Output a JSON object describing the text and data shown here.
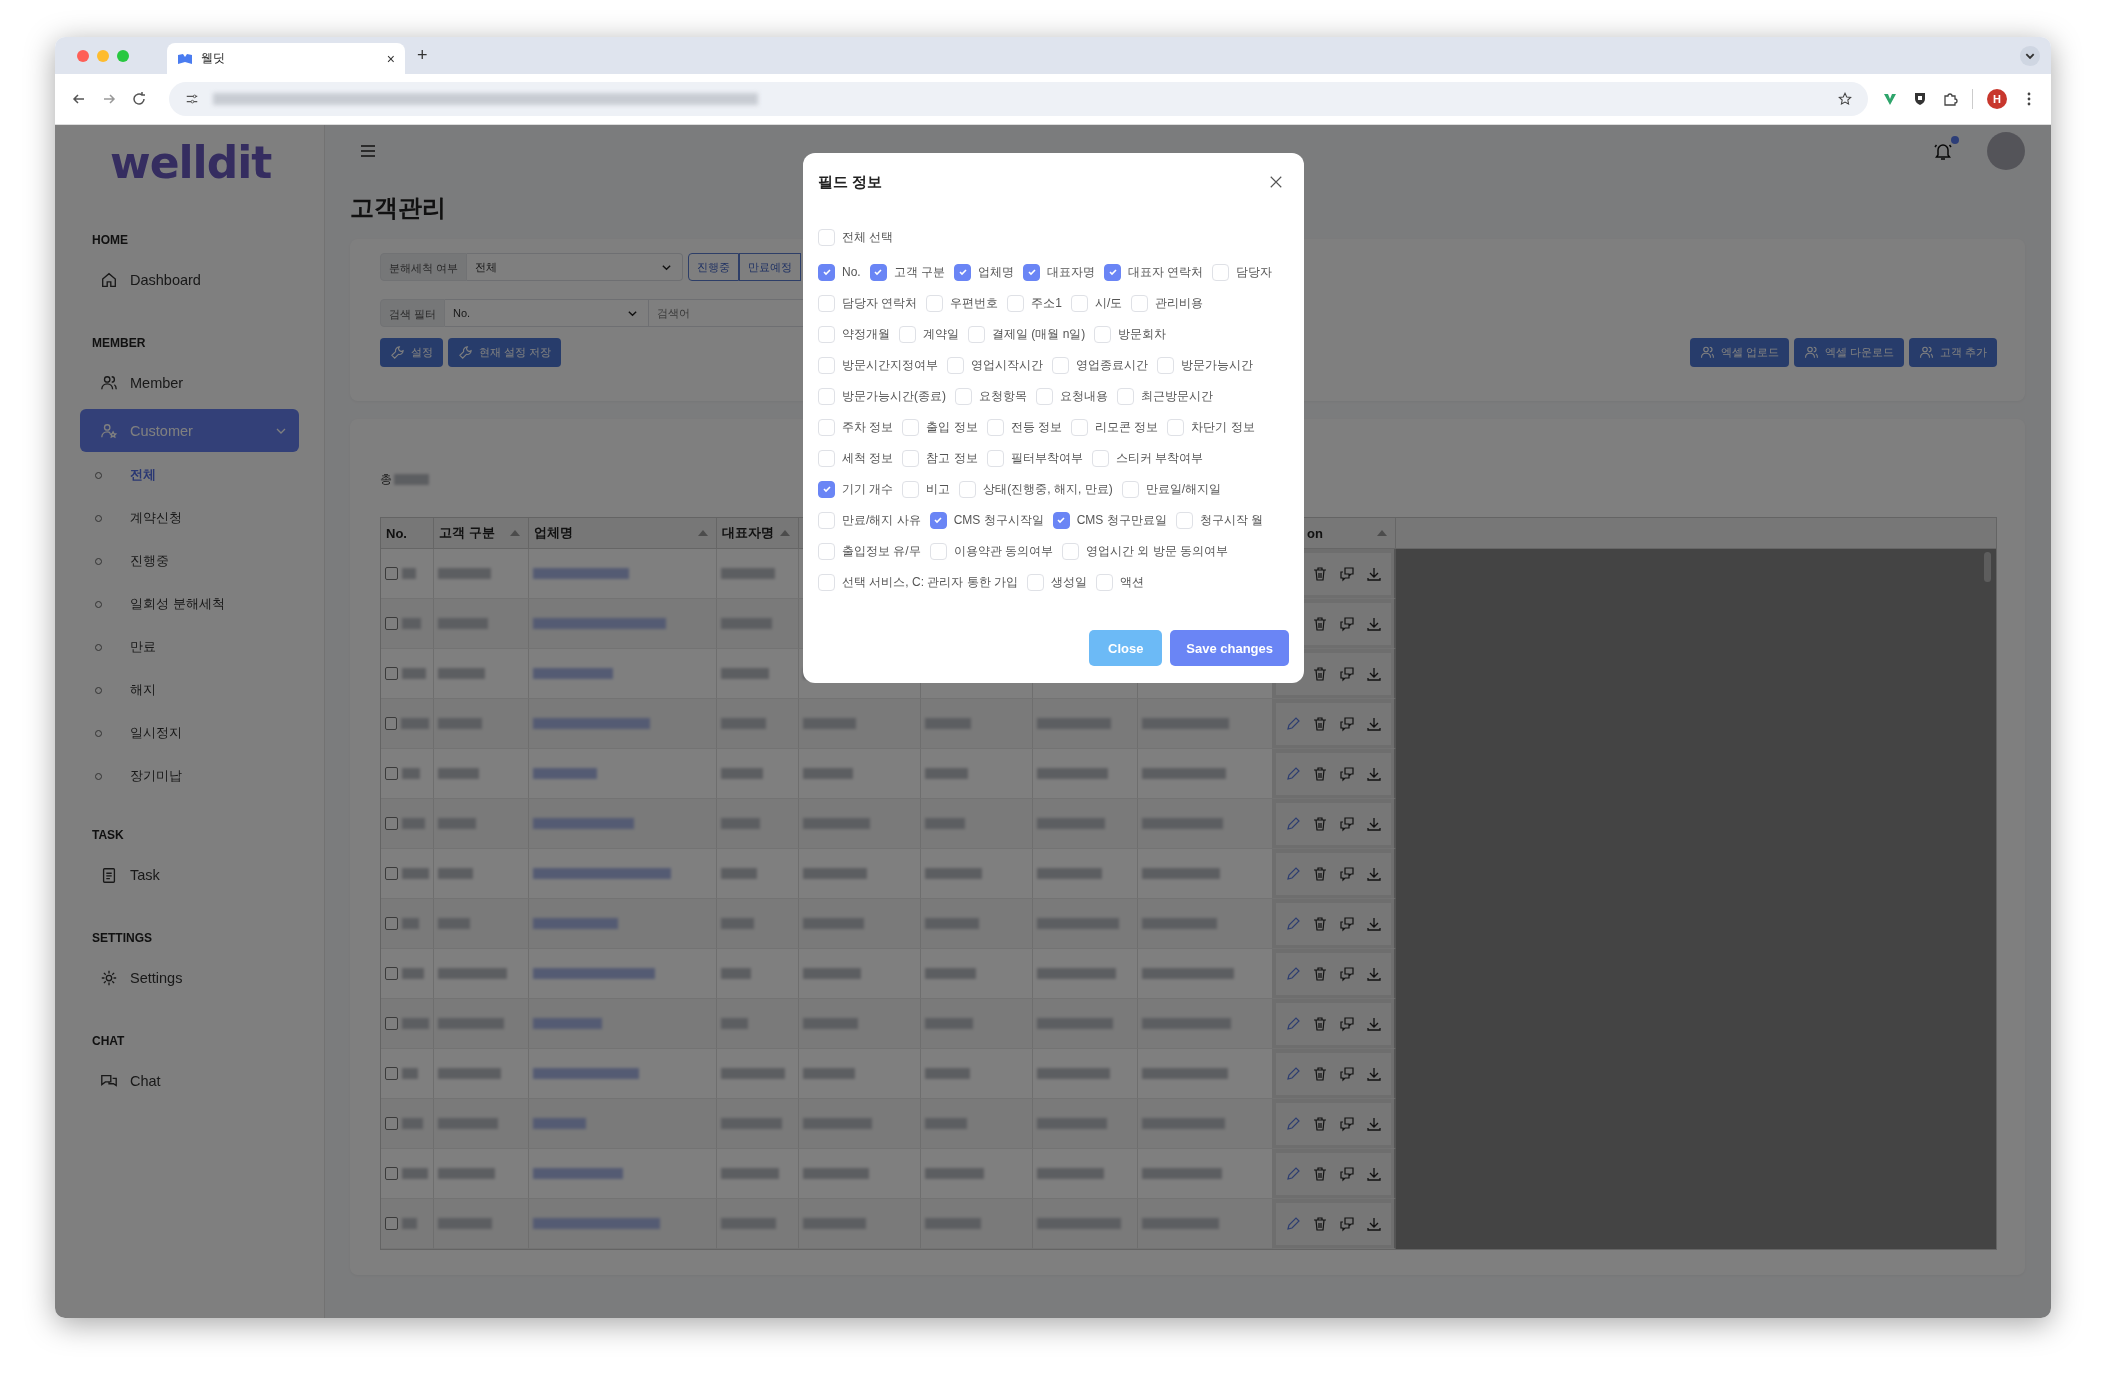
{
  "browser": {
    "tab_title": "웰딧",
    "new_tab": "+",
    "tab_close": "×",
    "profile": "H"
  },
  "sidebar": {
    "logo": "welldit",
    "sections": [
      {
        "heading": "HOME",
        "items": [
          {
            "label": "Dashboard",
            "selected": false
          }
        ]
      },
      {
        "heading": "MEMBER",
        "items": [
          {
            "label": "Member",
            "selected": false
          },
          {
            "label": "Customer",
            "selected": true,
            "expanded": true,
            "children": [
              {
                "label": "전체",
                "selected": true
              },
              {
                "label": "계약신청",
                "selected": false
              },
              {
                "label": "진행중",
                "selected": false
              },
              {
                "label": "일회성 분해세척",
                "selected": false
              },
              {
                "label": "만료",
                "selected": false
              },
              {
                "label": "해지",
                "selected": false
              },
              {
                "label": "일시정지",
                "selected": false
              },
              {
                "label": "장기미납",
                "selected": false
              }
            ]
          }
        ]
      },
      {
        "heading": "TASK",
        "items": [
          {
            "label": "Task",
            "selected": false
          }
        ]
      },
      {
        "heading": "SETTINGS",
        "items": [
          {
            "label": "Settings",
            "selected": false
          }
        ]
      },
      {
        "heading": "CHAT",
        "items": [
          {
            "label": "Chat",
            "selected": false
          }
        ]
      }
    ]
  },
  "page_title": "고객관리",
  "filters": {
    "cleaning": {
      "label": "분해세척 여부",
      "value": "전체"
    },
    "status_buttons": [
      "진행중",
      "만료예정"
    ],
    "search": {
      "label": "검색 필터",
      "value": "No.",
      "placeholder": "검색어"
    },
    "actions": [
      "설정",
      "현재 설정 저장"
    ],
    "right_actions": [
      "엑셀 업로드",
      "엑셀 다운로드",
      "고객 추가"
    ]
  },
  "table": {
    "total_label": "총",
    "columns": [
      {
        "label": "No.",
        "sortable": false
      },
      {
        "label": "고객 구분",
        "sortable": true
      },
      {
        "label": "업체명",
        "sortable": true
      },
      {
        "label": "대표자명",
        "sortable": true
      },
      {
        "label": "on",
        "sortable": true
      }
    ],
    "rows": [
      {
        "checked": false
      },
      {
        "checked": false
      },
      {
        "checked": false
      },
      {
        "checked": false
      },
      {
        "checked": false
      },
      {
        "checked": false
      },
      {
        "checked": false
      },
      {
        "checked": false
      },
      {
        "checked": false
      },
      {
        "checked": false
      },
      {
        "checked": false
      },
      {
        "checked": false
      },
      {
        "checked": false
      },
      {
        "checked": false
      }
    ]
  },
  "field_dialog": {
    "title": "필드 정보",
    "select_all": {
      "label": "전체 선택",
      "checked": false
    },
    "rows": [
      [
        {
          "label": "No.",
          "checked": true
        },
        {
          "label": "고객 구분",
          "checked": true
        },
        {
          "label": "업체명",
          "checked": true
        },
        {
          "label": "대표자명",
          "checked": true
        },
        {
          "label": "대표자 연락처",
          "checked": true
        },
        {
          "label": "담당자",
          "checked": false
        }
      ],
      [
        {
          "label": "담당자 연락처",
          "checked": false
        },
        {
          "label": "우편번호",
          "checked": false
        },
        {
          "label": "주소1",
          "checked": false
        },
        {
          "label": "시/도",
          "checked": false
        },
        {
          "label": "관리비용",
          "checked": false
        }
      ],
      [
        {
          "label": "약정개월",
          "checked": false
        },
        {
          "label": "계약일",
          "checked": false
        },
        {
          "label": "결제일 (매월 n일)",
          "checked": false
        },
        {
          "label": "방문회차",
          "checked": false
        }
      ],
      [
        {
          "label": "방문시간지정여부",
          "checked": false
        },
        {
          "label": "영업시작시간",
          "checked": false
        },
        {
          "label": "영업종료시간",
          "checked": false
        },
        {
          "label": "방문가능시간",
          "checked": false
        }
      ],
      [
        {
          "label": "방문가능시간(종료)",
          "checked": false
        },
        {
          "label": "요청항목",
          "checked": false
        },
        {
          "label": "요청내용",
          "checked": false
        },
        {
          "label": "최근방문시간",
          "checked": false
        }
      ],
      [
        {
          "label": "주차 정보",
          "checked": false
        },
        {
          "label": "출입 정보",
          "checked": false
        },
        {
          "label": "전등 정보",
          "checked": false
        },
        {
          "label": "리모콘 정보",
          "checked": false
        },
        {
          "label": "차단기 정보",
          "checked": false
        }
      ],
      [
        {
          "label": "세척 정보",
          "checked": false
        },
        {
          "label": "참고 정보",
          "checked": false
        },
        {
          "label": "필터부착여부",
          "checked": false
        },
        {
          "label": "스티커 부착여부",
          "checked": false
        }
      ],
      [
        {
          "label": "기기 개수",
          "checked": true
        },
        {
          "label": "비고",
          "checked": false
        },
        {
          "label": "상태(진행중, 해지, 만료)",
          "checked": false
        },
        {
          "label": "만료일/해지일",
          "checked": false
        }
      ],
      [
        {
          "label": "만료/해지 사유",
          "checked": false
        },
        {
          "label": "CMS 청구시작일",
          "checked": true
        },
        {
          "label": "CMS 청구만료일",
          "checked": true
        },
        {
          "label": "청구시작 월",
          "checked": false
        }
      ],
      [
        {
          "label": "출입정보 유/무",
          "checked": false
        },
        {
          "label": "이용약관 동의여부",
          "checked": false
        },
        {
          "label": "영업시간 외 방문 동의여부",
          "checked": false
        }
      ],
      [
        {
          "label": "선택 서비스, C: 관리자 통한 가입",
          "checked": false
        },
        {
          "label": "생성일",
          "checked": false
        },
        {
          "label": "액션",
          "checked": false
        }
      ]
    ],
    "buttons": [
      "Close",
      "Save changes"
    ]
  }
}
